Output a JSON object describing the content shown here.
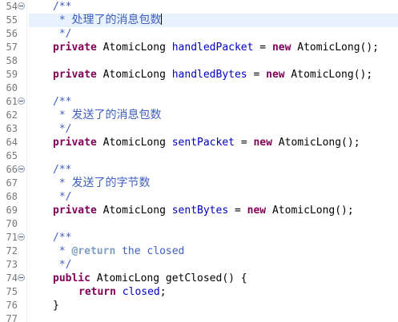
{
  "editor": {
    "lines": [
      {
        "num": "54",
        "fold": true,
        "kind": "jdoc",
        "parts": [
          {
            "c": "jdoc",
            "t": "/**"
          }
        ]
      },
      {
        "num": "55",
        "fold": false,
        "kind": "jdoc",
        "parts": [
          {
            "c": "jdoc",
            "t": " * "
          },
          {
            "c": "jdoc-cn",
            "t": "处理了的消息包数"
          }
        ],
        "caret": true
      },
      {
        "num": "56",
        "fold": false,
        "kind": "jdoc",
        "parts": [
          {
            "c": "jdoc",
            "t": " */"
          }
        ]
      },
      {
        "num": "57",
        "fold": false,
        "kind": "code",
        "parts": [
          {
            "c": "kw",
            "t": "private"
          },
          {
            "c": "plain",
            "t": " AtomicLong "
          },
          {
            "c": "field",
            "t": "handledPacket"
          },
          {
            "c": "plain",
            "t": " = "
          },
          {
            "c": "kw",
            "t": "new"
          },
          {
            "c": "plain",
            "t": " AtomicLong();"
          }
        ]
      },
      {
        "num": "58",
        "fold": false,
        "kind": "blank",
        "parts": []
      },
      {
        "num": "59",
        "fold": false,
        "kind": "code",
        "parts": [
          {
            "c": "kw",
            "t": "private"
          },
          {
            "c": "plain",
            "t": " AtomicLong "
          },
          {
            "c": "field",
            "t": "handledBytes"
          },
          {
            "c": "plain",
            "t": " = "
          },
          {
            "c": "kw",
            "t": "new"
          },
          {
            "c": "plain",
            "t": " AtomicLong();"
          }
        ]
      },
      {
        "num": "60",
        "fold": false,
        "kind": "blank",
        "parts": []
      },
      {
        "num": "61",
        "fold": true,
        "kind": "jdoc",
        "parts": [
          {
            "c": "jdoc",
            "t": "/**"
          }
        ]
      },
      {
        "num": "62",
        "fold": false,
        "kind": "jdoc",
        "parts": [
          {
            "c": "jdoc",
            "t": " * "
          },
          {
            "c": "jdoc-cn",
            "t": "发送了的消息包数"
          }
        ]
      },
      {
        "num": "63",
        "fold": false,
        "kind": "jdoc",
        "parts": [
          {
            "c": "jdoc",
            "t": " */"
          }
        ]
      },
      {
        "num": "64",
        "fold": false,
        "kind": "code",
        "parts": [
          {
            "c": "kw",
            "t": "private"
          },
          {
            "c": "plain",
            "t": " AtomicLong "
          },
          {
            "c": "field",
            "t": "sentPacket"
          },
          {
            "c": "plain",
            "t": " = "
          },
          {
            "c": "kw",
            "t": "new"
          },
          {
            "c": "plain",
            "t": " AtomicLong();"
          }
        ]
      },
      {
        "num": "65",
        "fold": false,
        "kind": "blank",
        "parts": []
      },
      {
        "num": "66",
        "fold": true,
        "kind": "jdoc",
        "parts": [
          {
            "c": "jdoc",
            "t": "/**"
          }
        ]
      },
      {
        "num": "67",
        "fold": false,
        "kind": "jdoc",
        "parts": [
          {
            "c": "jdoc",
            "t": " * "
          },
          {
            "c": "jdoc-cn",
            "t": "发送了的字节数"
          }
        ]
      },
      {
        "num": "68",
        "fold": false,
        "kind": "jdoc",
        "parts": [
          {
            "c": "jdoc",
            "t": " */"
          }
        ]
      },
      {
        "num": "69",
        "fold": false,
        "kind": "code",
        "parts": [
          {
            "c": "kw",
            "t": "private"
          },
          {
            "c": "plain",
            "t": " AtomicLong "
          },
          {
            "c": "field",
            "t": "sentBytes"
          },
          {
            "c": "plain",
            "t": " = "
          },
          {
            "c": "kw",
            "t": "new"
          },
          {
            "c": "plain",
            "t": " AtomicLong();"
          }
        ]
      },
      {
        "num": "70",
        "fold": false,
        "kind": "blank",
        "parts": []
      },
      {
        "num": "71",
        "fold": true,
        "kind": "jdoc",
        "parts": [
          {
            "c": "jdoc",
            "t": "/**"
          }
        ]
      },
      {
        "num": "72",
        "fold": false,
        "kind": "jdoc",
        "parts": [
          {
            "c": "jdoc",
            "t": " * "
          },
          {
            "c": "tag",
            "t": "@return"
          },
          {
            "c": "jdoc",
            "t": " the closed"
          }
        ]
      },
      {
        "num": "73",
        "fold": false,
        "kind": "jdoc",
        "parts": [
          {
            "c": "jdoc",
            "t": " */"
          }
        ]
      },
      {
        "num": "74",
        "fold": true,
        "kind": "code",
        "parts": [
          {
            "c": "kw",
            "t": "public"
          },
          {
            "c": "plain",
            "t": " AtomicLong getClosed() {"
          }
        ]
      },
      {
        "num": "75",
        "fold": false,
        "kind": "code2",
        "parts": [
          {
            "c": "kw",
            "t": "return"
          },
          {
            "c": "plain",
            "t": " "
          },
          {
            "c": "field",
            "t": "closed"
          },
          {
            "c": "plain",
            "t": ";"
          }
        ]
      },
      {
        "num": "76",
        "fold": false,
        "kind": "code",
        "parts": [
          {
            "c": "plain",
            "t": "}"
          }
        ]
      },
      {
        "num": "77",
        "fold": false,
        "kind": "blank",
        "parts": []
      }
    ]
  },
  "colors": {
    "keyword": "#7f0055",
    "javadoc": "#3f5fbf",
    "field": "#0000c0",
    "javadoc_tag": "#7f9fbf",
    "line_number": "#787878",
    "current_line_highlight": "#e8f2fe"
  }
}
